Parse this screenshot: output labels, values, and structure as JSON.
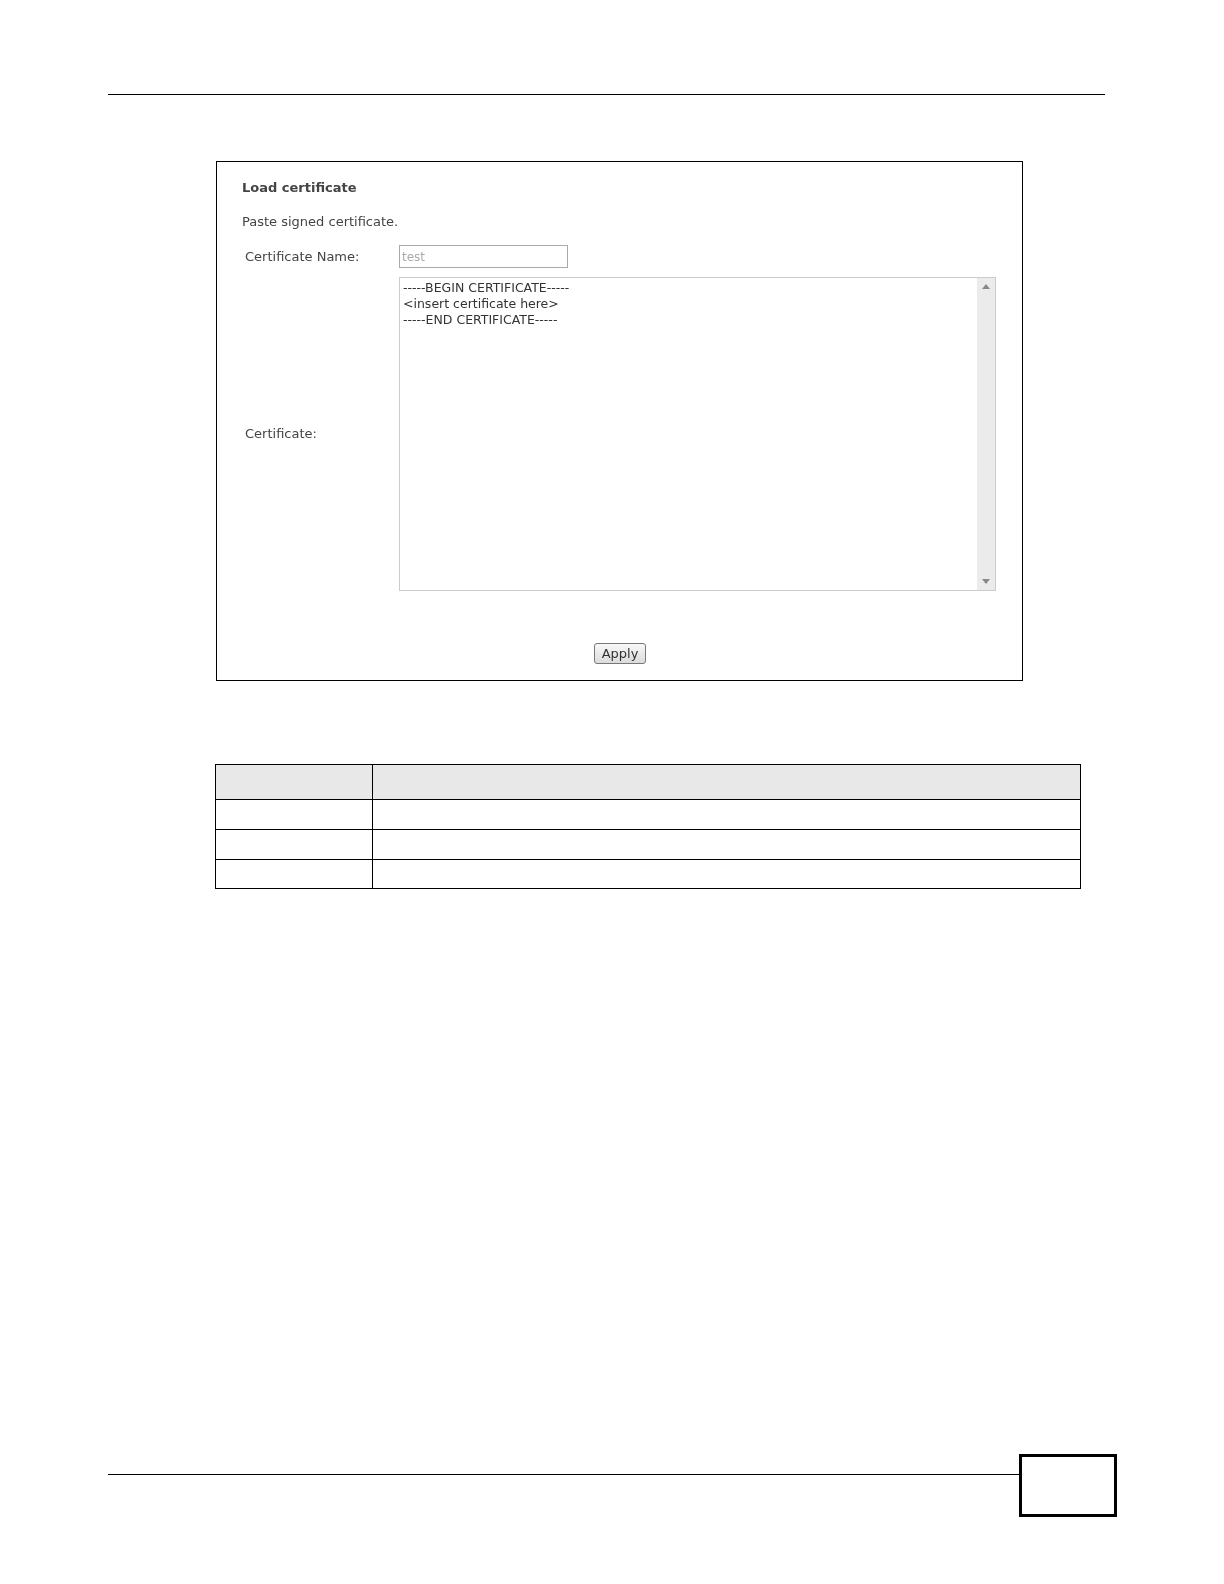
{
  "panel": {
    "title": "Load certificate",
    "description": "Paste signed certificate.",
    "name_field": {
      "label": "Certificate Name:",
      "placeholder": "test"
    },
    "certificate_field": {
      "label": "Certificate:",
      "value": "-----BEGIN CERTIFICATE-----\n<insert certificate here>\n-----END CERTIFICATE-----"
    },
    "apply_button": "Apply"
  }
}
